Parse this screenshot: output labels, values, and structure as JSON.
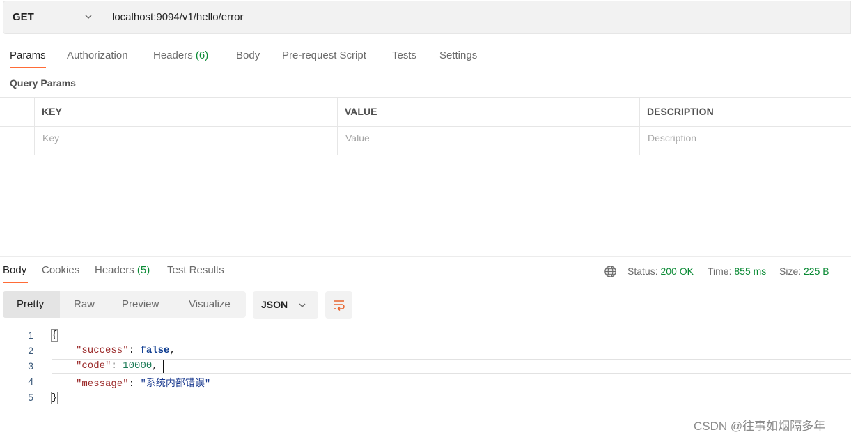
{
  "request": {
    "method": "GET",
    "url": "localhost:9094/v1/hello/error",
    "tabs": [
      {
        "label": "Params"
      },
      {
        "label": "Authorization"
      },
      {
        "label": "Headers",
        "count": "(6)"
      },
      {
        "label": "Body"
      },
      {
        "label": "Pre-request Script"
      },
      {
        "label": "Tests"
      },
      {
        "label": "Settings"
      }
    ],
    "section_title": "Query Params",
    "table": {
      "headers": [
        "KEY",
        "VALUE",
        "DESCRIPTION"
      ],
      "placeholders": [
        "Key",
        "Value",
        "Description"
      ]
    }
  },
  "response": {
    "tabs": [
      {
        "label": "Body"
      },
      {
        "label": "Cookies"
      },
      {
        "label": "Headers",
        "count": "(5)"
      },
      {
        "label": "Test Results"
      }
    ],
    "status_label": "Status:",
    "status_value": "200 OK",
    "time_label": "Time:",
    "time_value": "855 ms",
    "size_label": "Size:",
    "size_value": "225 B",
    "view_modes": [
      "Pretty",
      "Raw",
      "Preview",
      "Visualize"
    ],
    "format": "JSON",
    "line_numbers": [
      "1",
      "2",
      "3",
      "4",
      "5"
    ],
    "code": {
      "open_brace": "{",
      "close_brace": "}",
      "k1": "\"success\"",
      "v1": "false",
      "k2": "\"code\"",
      "v2": "10000",
      "k3": "\"message\"",
      "v3": "\"系统内部错误\"",
      "colon": ": ",
      "comma": ","
    }
  },
  "watermark": "CSDN @往事如烟隔多年",
  "colors": {
    "accent": "#ff6c37",
    "count_green": "#0a8a34"
  },
  "icons": [
    "chevron-down-icon",
    "globe-icon",
    "wrap-lines-icon"
  ]
}
